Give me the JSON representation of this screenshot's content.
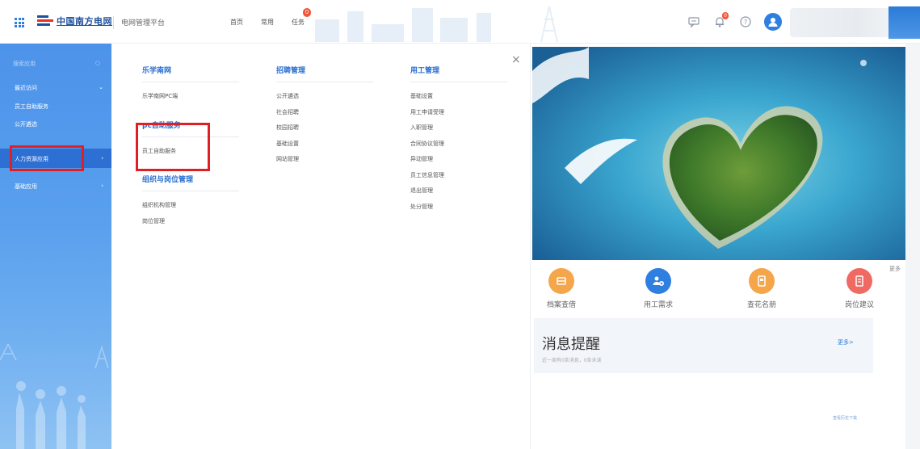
{
  "header": {
    "brand": "中国南方电网",
    "platform": "电网管理平台",
    "nav": [
      {
        "label": "首页"
      },
      {
        "label": "常用"
      },
      {
        "label": "任务",
        "badge": "0"
      }
    ],
    "icons": [
      "chat-icon",
      "bell-icon",
      "help-icon",
      "user-avatar"
    ],
    "bell_badge": "0"
  },
  "sidebar": {
    "search_placeholder": "搜索应用",
    "recent": "最近访问",
    "recent_items": [
      "员工自助服务",
      "公开遴选"
    ],
    "items": [
      {
        "label": "人力资源应用",
        "active": true
      },
      {
        "label": "基础应用",
        "active": false
      }
    ]
  },
  "menu": {
    "columns": [
      {
        "groups": [
          {
            "title": "乐学南网",
            "items": [
              "乐学南网PC端"
            ]
          },
          {
            "title": "pc自助服务",
            "items": [
              "员工自助服务"
            ]
          },
          {
            "title": "组织与岗位管理",
            "items": [
              "组织机构管理",
              "岗位管理"
            ]
          }
        ]
      },
      {
        "groups": [
          {
            "title": "招聘管理",
            "items": [
              "公开遴选",
              "社会招聘",
              "校园招聘",
              "基础设置",
              "网站管理"
            ]
          }
        ]
      },
      {
        "groups": [
          {
            "title": "用工管理",
            "items": [
              "基础设置",
              "用工申请受理",
              "入职管理",
              "合同协议管理",
              "异动管理",
              "员工信息管理",
              "退出管理",
              "处分管理"
            ]
          }
        ]
      }
    ],
    "close": "×"
  },
  "right": {
    "quick_more": "更多",
    "quick": [
      {
        "label": "档案查借",
        "color": "#f5a54a",
        "icon": "archive-icon"
      },
      {
        "label": "用工需求",
        "color": "#2f7fe0",
        "icon": "add-user-icon"
      },
      {
        "label": "查花名册",
        "color": "#f5a54a",
        "icon": "roster-icon"
      },
      {
        "label": "岗位建议",
        "color": "#ef6a62",
        "icon": "document-icon"
      }
    ],
    "message": {
      "title": "消息提醒",
      "subtitle": "近一周有0条消息，0条未读",
      "more": "更多>"
    },
    "footer_link": "查看历史下载"
  },
  "colors": {
    "accent": "#2f7fe0",
    "sidebar": "#4c93ea",
    "highlight": "#e21e25"
  }
}
